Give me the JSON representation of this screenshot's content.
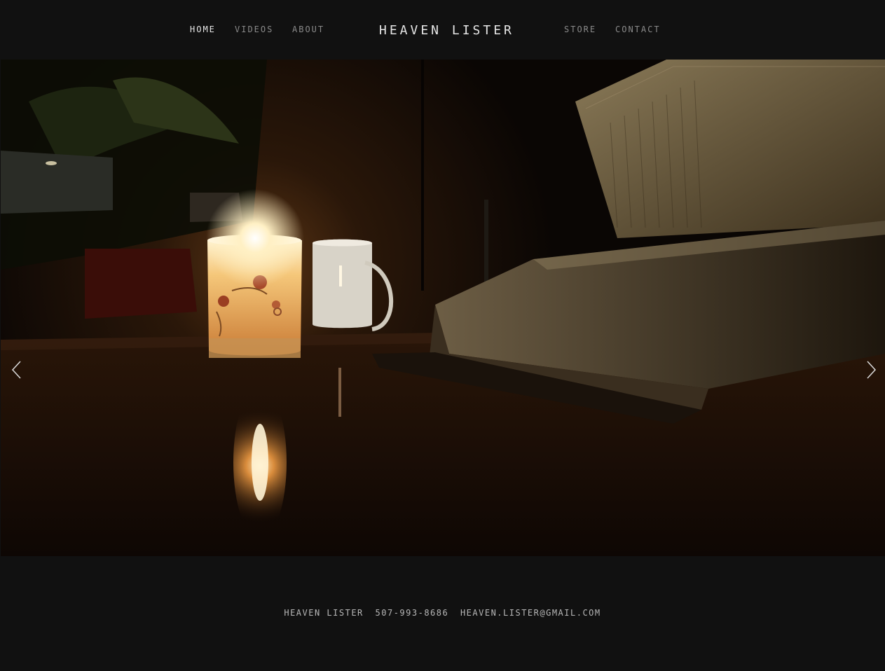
{
  "nav": {
    "left": [
      {
        "label": "HOME",
        "active": true
      },
      {
        "label": "VIDEOS"
      },
      {
        "label": "ABOUT"
      }
    ],
    "right": [
      {
        "label": "STORE"
      },
      {
        "label": "CONTACT"
      }
    ]
  },
  "site_title": "HEAVEN LISTER",
  "hero": {
    "prev_icon": "chevron-left-icon",
    "next_icon": "chevron-right-icon"
  },
  "footer": {
    "name": "HEAVEN LISTER",
    "phone": "507-993-8686",
    "email": "HEAVEN.LISTER@GMAIL.COM"
  }
}
